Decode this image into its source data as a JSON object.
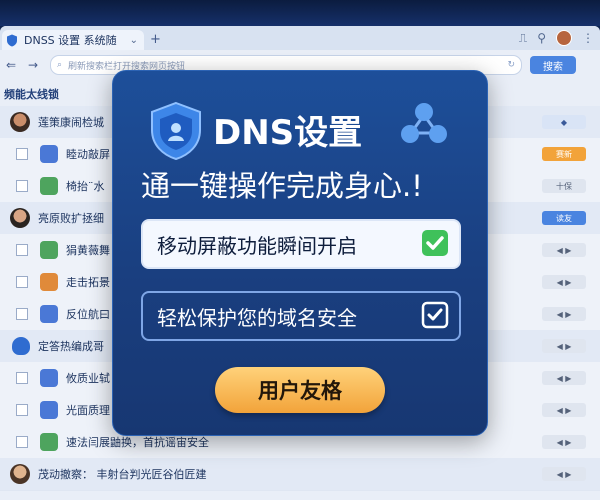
{
  "browser": {
    "tab_title": "DNSS 设置 系统随",
    "tab_close": "⌄",
    "tab_add": "+",
    "address_text": "刷新搜索栏打开搜索网页按钮",
    "go_button": "搜索"
  },
  "sidebar": {
    "title": "频能太线锁"
  },
  "list": {
    "rows": [
      {
        "text": "莲策康闹检城",
        "kind": "group",
        "button": "◆"
      },
      {
        "text": "睦动敲屏",
        "kind": "item",
        "icon_color": "#4a78d6",
        "button": "赛新",
        "button_style": "orange"
      },
      {
        "text": "椅抬¨水",
        "kind": "item",
        "icon_color": "#4ea45e",
        "button": "十保",
        "button_style": "gray"
      },
      {
        "text": "亮原败扩拯细",
        "kind": "group",
        "button": "读友",
        "button_style": "blue"
      },
      {
        "text": "狷黄薇舞",
        "kind": "item",
        "icon_color": "#4ea45e",
        "button": "◀ ▶",
        "button_style": "gray"
      },
      {
        "text": "走击拓景",
        "kind": "item",
        "icon_color": "#e08a3a",
        "button": "◀ ▶",
        "button_style": "gray"
      },
      {
        "text": "反位航曰",
        "kind": "item",
        "icon_color": "#4a78d6",
        "button": "◀ ▶",
        "button_style": "gray"
      },
      {
        "text": "定答热编成哥",
        "kind": "group",
        "button": "◀ ▶",
        "button_style": "gray"
      },
      {
        "text": "攸质业轼",
        "kind": "item",
        "icon_color": "#4a78d6",
        "button": "◀ ▶",
        "button_style": "gray"
      },
      {
        "text": "光面质理",
        "kind": "item",
        "icon_color": "#4a78d6",
        "button": "◀ ▶",
        "button_style": "gray"
      },
      {
        "text": "速法闫展鼬换，首抗谣宙安全",
        "kind": "item",
        "icon_color": "#4ea45e",
        "button": "◀ ▶",
        "button_style": "gray"
      },
      {
        "text": "茂动撤察：  丰射台判光匠谷伯匠建",
        "kind": "group-avatar",
        "button": "◀ ▶",
        "button_style": "gray"
      }
    ]
  },
  "popup": {
    "title": "DNS设置",
    "subtitle": "通一键操作完成身心.!",
    "feature1": "移动屏蔽功能瞬间开启",
    "feature2": "轻松保护您的域名安全",
    "cta": "用户友格"
  },
  "colors": {
    "accent": "#1d4f9a",
    "cta": "#f2a33a",
    "check_green": "#3fc15a"
  }
}
